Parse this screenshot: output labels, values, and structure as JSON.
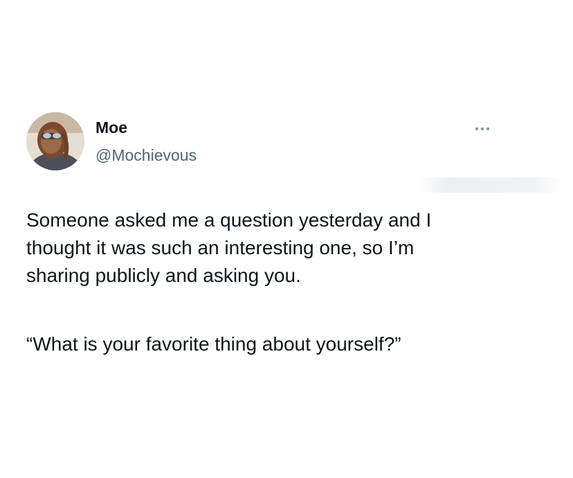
{
  "author": {
    "display_name": "Moe",
    "handle": "@Mochievous",
    "avatar_icon": "profile-photo"
  },
  "menu": {
    "icon": "more-horizontal-icon"
  },
  "tweet": {
    "line1": "Someone asked me a question yesterday and I",
    "line2": "thought it was such an interesting one, so I’m",
    "line3": "sharing publicly and asking you.",
    "quote": "“What is your favorite thing about yourself?”"
  },
  "colors": {
    "text_primary": "#0f1419",
    "text_secondary": "#536471",
    "background": "#ffffff"
  }
}
